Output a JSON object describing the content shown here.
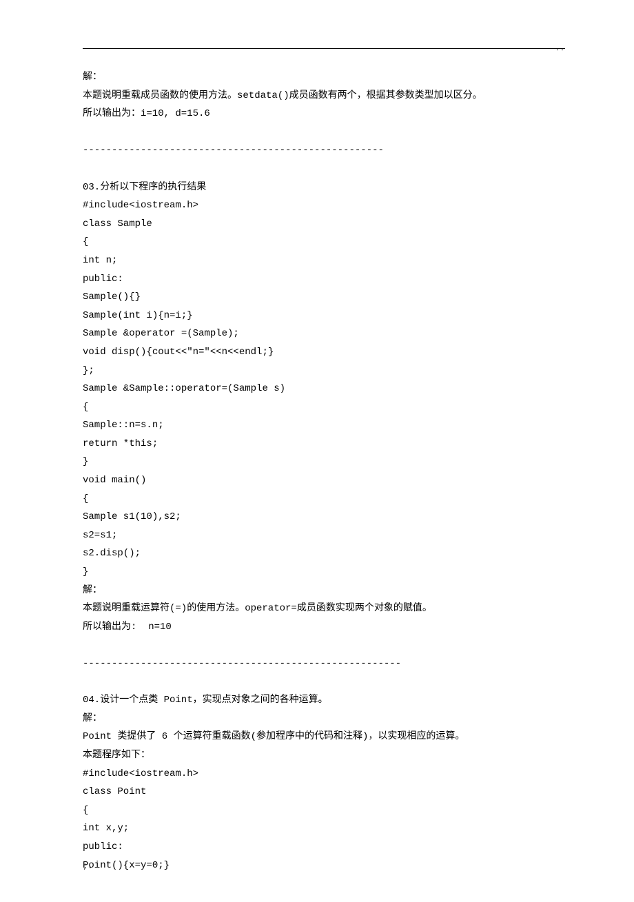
{
  "topDots": "..",
  "lines": [
    "解：",
    "本题说明重载成员函数的使用方法。setdata()成员函数有两个，根据其参数类型加以区分。",
    "所以输出为：i=10, d=15.6",
    "",
    "----------------------------------------------------",
    "",
    "03.分析以下程序的执行结果",
    "#include<iostream.h>",
    "class Sample",
    "{",
    "int n;",
    "public:",
    "Sample(){}",
    "Sample(int i){n=i;}",
    "Sample &operator =(Sample);",
    "void disp(){cout<<\"n=\"<<n<<endl;}",
    "};",
    "Sample &Sample::operator=(Sample s)",
    "{",
    "Sample::n=s.n;",
    "return *this;",
    "}",
    "void main()",
    "{",
    "Sample s1(10),s2;",
    "s2=s1;",
    "s2.disp();",
    "}",
    "解：",
    "本题说明重载运算符(=)的使用方法。operator=成员函数实现两个对象的赋值。",
    "所以输出为:  n=10",
    "",
    "-------------------------------------------------------",
    "",
    "04.设计一个点类 Point，实现点对象之间的各种运算。",
    "解：",
    "Point 类提供了 6 个运算符重载函数(参加程序中的代码和注释)，以实现相应的运算。",
    "本题程序如下：",
    "#include<iostream.h>",
    "class Point",
    "{",
    "int x,y;",
    "public:",
    "Point(){x=y=0;}"
  ],
  "footerMark": ";."
}
